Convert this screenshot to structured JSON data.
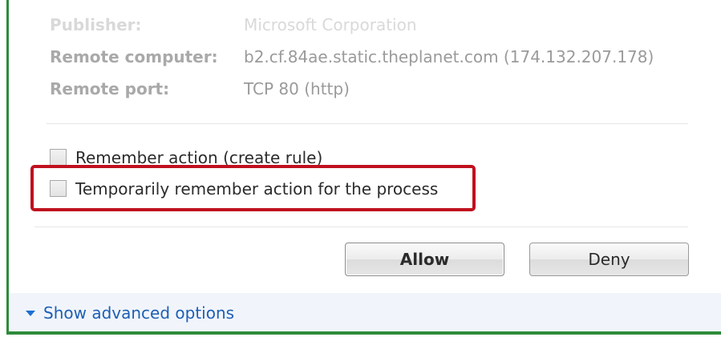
{
  "details": {
    "publisher": {
      "label": "Publisher:",
      "value": "Microsoft Corporation"
    },
    "remote_computer": {
      "label": "Remote computer:",
      "value": "b2.cf.84ae.static.theplanet.com (174.132.207.178)"
    },
    "remote_port": {
      "label": "Remote port:",
      "value": "TCP 80 (http)"
    }
  },
  "options": {
    "remember_action": "Remember action (create rule)",
    "temporarily_remember": "Temporarily remember action for the process"
  },
  "buttons": {
    "allow": "Allow",
    "deny": "Deny"
  },
  "footer": {
    "advanced_options": "Show advanced options"
  },
  "colors": {
    "highlight": "#c0101e",
    "link": "#1e5fb4",
    "window_border": "#2e8b3a"
  }
}
